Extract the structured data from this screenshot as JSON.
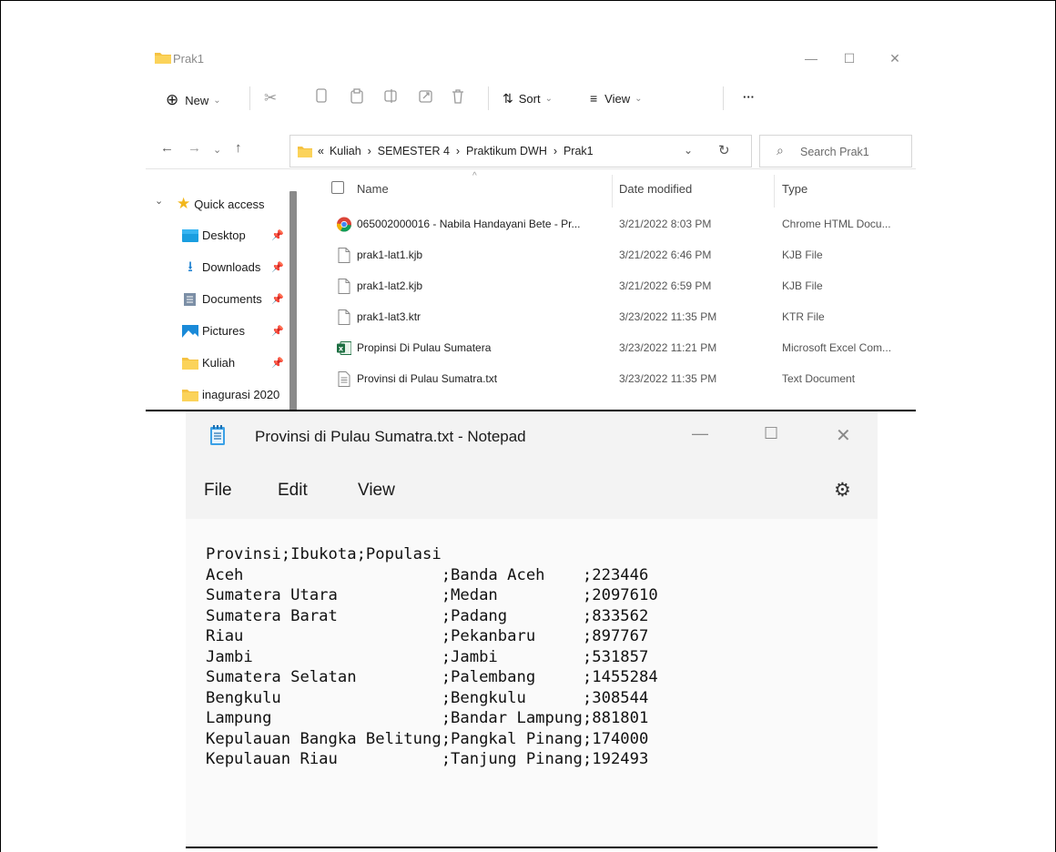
{
  "explorer": {
    "title": "Prak1",
    "commands": {
      "new": "New",
      "sort": "Sort",
      "view": "View",
      "more": "···"
    },
    "breadcrumb": "Kuliah  ›  SEMESTER 4  ›  Praktikum DWH  ›  Prak1",
    "breadcrumb_prefix": "«",
    "search_placeholder": "Search Prak1",
    "nav": {
      "quick_access": "Quick access",
      "items": [
        {
          "label": "Desktop",
          "icon": "desktop-icon"
        },
        {
          "label": "Downloads",
          "icon": "download-icon"
        },
        {
          "label": "Documents",
          "icon": "documents-icon"
        },
        {
          "label": "Pictures",
          "icon": "pictures-icon"
        },
        {
          "label": "Kuliah",
          "icon": "folder-icon"
        },
        {
          "label": "inagurasi 2020",
          "icon": "folder-icon"
        }
      ]
    },
    "columns": {
      "name": "Name",
      "date": "Date modified",
      "type": "Type"
    },
    "files": [
      {
        "name": "065002000016 - Nabila Handayani Bete - Pr...",
        "date": "3/21/2022 8:03 PM",
        "type": "Chrome HTML Docu...",
        "icon": "chrome-icon"
      },
      {
        "name": "prak1-lat1.kjb",
        "date": "3/21/2022 6:46 PM",
        "type": "KJB File",
        "icon": "file-icon"
      },
      {
        "name": "prak1-lat2.kjb",
        "date": "3/21/2022 6:59 PM",
        "type": "KJB File",
        "icon": "file-icon"
      },
      {
        "name": "prak1-lat3.ktr",
        "date": "3/23/2022 11:35 PM",
        "type": "KTR File",
        "icon": "file-icon"
      },
      {
        "name": "Propinsi Di Pulau Sumatera",
        "date": "3/23/2022 11:21 PM",
        "type": "Microsoft Excel Com...",
        "icon": "excel-icon"
      },
      {
        "name": "Provinsi di Pulau Sumatra.txt",
        "date": "3/23/2022 11:35 PM",
        "type": "Text Document",
        "icon": "text-file-icon"
      }
    ]
  },
  "notepad": {
    "title": "Provinsi di Pulau Sumatra.txt - Notepad",
    "menu": {
      "file": "File",
      "edit": "Edit",
      "view": "View"
    },
    "lines": [
      "Provinsi;Ibukota;Populasi",
      "Aceh                     ;Banda Aceh    ;223446",
      "Sumatera Utara           ;Medan         ;2097610",
      "Sumatera Barat           ;Padang        ;833562",
      "Riau                     ;Pekanbaru     ;897767",
      "Jambi                    ;Jambi         ;531857",
      "Sumatera Selatan         ;Palembang     ;1455284",
      "Bengkulu                 ;Bengkulu      ;308544",
      "Lampung                  ;Bandar Lampung;881801",
      "Kepulauan Bangka Belitung;Pangkal Pinang;174000",
      "Kepulauan Riau           ;Tanjung Pinang;192493"
    ]
  }
}
